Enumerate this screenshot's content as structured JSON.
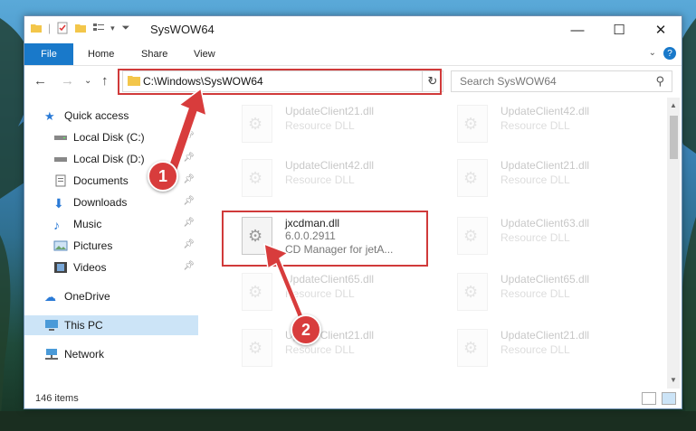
{
  "window": {
    "title": "SysWOW64"
  },
  "ribbon": {
    "file": "File",
    "tabs": [
      "Home",
      "Share",
      "View"
    ],
    "help": "?"
  },
  "address": {
    "path": "C:\\Windows\\SysWOW64"
  },
  "search": {
    "placeholder": "Search SysWOW64"
  },
  "sidebar": {
    "items": [
      {
        "label": "Quick access"
      },
      {
        "label": "Local Disk (C:)"
      },
      {
        "label": "Local Disk (D:)"
      },
      {
        "label": "Documents"
      },
      {
        "label": "Downloads"
      },
      {
        "label": "Music"
      },
      {
        "label": "Pictures"
      },
      {
        "label": "Videos"
      },
      {
        "label": "OneDrive"
      },
      {
        "label": "This PC"
      },
      {
        "label": "Network"
      }
    ]
  },
  "files": {
    "left": [
      {
        "name": "UpdateClient21.dll",
        "type": "Resource DLL"
      },
      {
        "name": "UpdateClient42.dll",
        "type": "Resource DLL"
      },
      {
        "name": "jxcdman.dll",
        "version": "6.0.0.2911",
        "desc": "CD Manager for jetA..."
      },
      {
        "name": "UpdateClient65.dll",
        "type": "Resource DLL"
      },
      {
        "name": "UpdateClient21.dll",
        "type": "Resource DLL"
      }
    ],
    "right": [
      {
        "name": "UpdateClient42.dll",
        "type": "Resource DLL"
      },
      {
        "name": "UpdateClient21.dll",
        "type": "Resource DLL"
      },
      {
        "name": "UpdateClient63.dll",
        "type": "Resource DLL"
      },
      {
        "name": "UpdateClient65.dll",
        "type": "Resource DLL"
      },
      {
        "name": "UpdateClient21.dll",
        "type": "Resource DLL"
      }
    ]
  },
  "status": {
    "count": "146 items"
  },
  "callouts": {
    "one": "1",
    "two": "2"
  },
  "colors": {
    "accent": "#1979ca",
    "highlight": "#d03a3a",
    "selection": "#cce4f7"
  }
}
